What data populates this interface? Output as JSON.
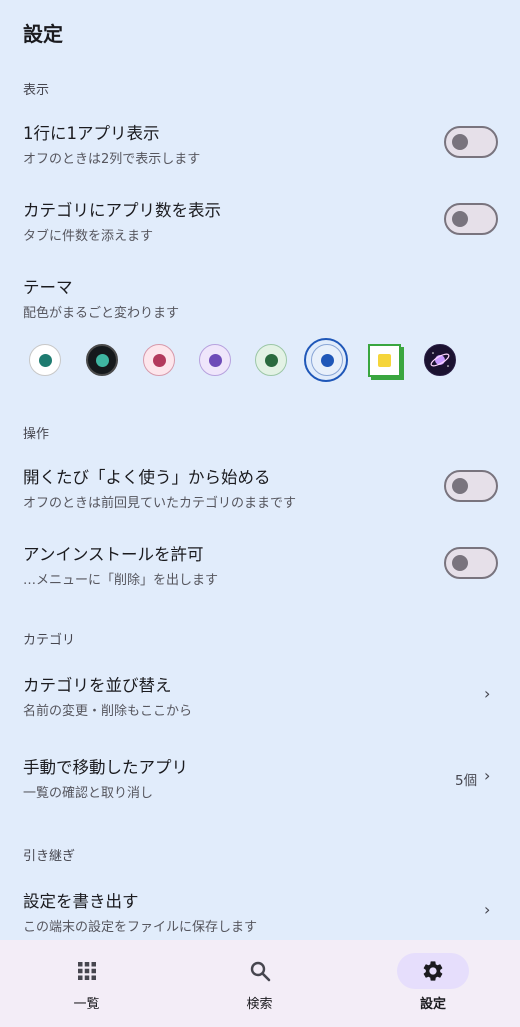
{
  "header": {
    "title": "設定"
  },
  "sections": {
    "display": "表示",
    "operation": "操作",
    "category": "カテゴリ",
    "transfer": "引き継ぎ"
  },
  "settings": {
    "one_per_row": {
      "title": "1行に1アプリ表示",
      "subtitle": "オフのときは2列で表示します",
      "enabled": false
    },
    "category_count": {
      "title": "カテゴリにアプリ数を表示",
      "subtitle": "タブに件数を添えます",
      "enabled": false
    },
    "theme": {
      "title": "テーマ",
      "subtitle": "配色がまるごと変わります",
      "selected_index": 5
    },
    "open_frequent": {
      "title": "開くたび「よく使う」から始める",
      "subtitle": "オフのときは前回見ていたカテゴリのままです",
      "enabled": false
    },
    "allow_uninstall": {
      "title": "アンインストールを許可",
      "subtitle": "…メニューに「削除」を出します",
      "enabled": false
    },
    "reorder_categories": {
      "title": "カテゴリを並び替え",
      "subtitle": "名前の変更・削除もここから",
      "chevron": "›"
    },
    "moved_apps": {
      "title": "手動で移動したアプリ",
      "subtitle": "一覧の確認と取り消し",
      "count": "5個",
      "chevron": "›"
    },
    "export_settings": {
      "title": "設定を書き出す",
      "subtitle": "この端末の設定をファイルに保存します",
      "chevron": "›"
    }
  },
  "theme_swatches": [
    {
      "name": "light-teal",
      "bg": "#ffffff",
      "dot": "#1e7b70",
      "ring": "#c8c8c8"
    },
    {
      "name": "dark-teal",
      "bg": "#15191c",
      "dot": "#3fb6a2",
      "ring": "#8a8a8a"
    },
    {
      "name": "pink",
      "bg": "#fde6ec",
      "dot": "#b23a5c",
      "ring": "#d79aab"
    },
    {
      "name": "lavender",
      "bg": "#efe6fb",
      "dot": "#6d4bb8",
      "ring": "#b7a2de"
    },
    {
      "name": "green",
      "bg": "#e3f2e5",
      "dot": "#2b6a3f",
      "ring": "#9cc7a6"
    },
    {
      "name": "blue",
      "bg": "#e8f0fb",
      "dot": "#1f57b8",
      "ring": "#1f57b8"
    },
    {
      "name": "yellow-square",
      "bg": "#ffffff",
      "dot": "#f5d53a",
      "ring": "#3aa63f"
    },
    {
      "name": "space",
      "bg": "#1b1230",
      "dot": "#e3a6ff",
      "ring": "#2a1f45"
    }
  ],
  "nav": [
    {
      "label": "一覧",
      "icon": "grid-icon",
      "active": false
    },
    {
      "label": "検索",
      "icon": "search-icon",
      "active": false
    },
    {
      "label": "設定",
      "icon": "gear-icon",
      "active": true
    }
  ]
}
